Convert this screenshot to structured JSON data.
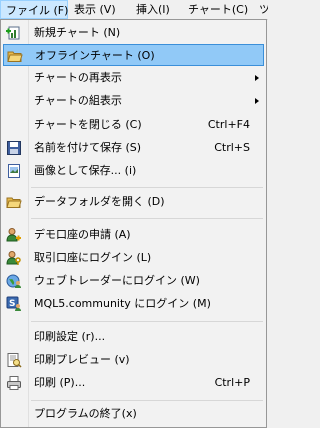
{
  "menubar": {
    "file": "ファイル (F)",
    "view": "表示 (V)",
    "insert": "挿入(I)",
    "chart": "チャート(C)",
    "tools": "ツ"
  },
  "menu": {
    "new_chart": {
      "label": "新規チャート (N)"
    },
    "offline_chart": {
      "label": "オフラインチャート (O)"
    },
    "chart_reshow": {
      "label": "チャートの再表示"
    },
    "chart_tile": {
      "label": "チャートの組表示"
    },
    "close_chart": {
      "label": "チャートを閉じる (C)",
      "shortcut": "Ctrl+F4"
    },
    "save_as": {
      "label": "名前を付けて保存 (S)",
      "shortcut": "Ctrl+S"
    },
    "save_picture": {
      "label": "画像として保存... (i)"
    },
    "open_data_folder": {
      "label": "データフォルダを開く (D)"
    },
    "demo_account": {
      "label": "デモ口座の申請 (A)"
    },
    "login_trade": {
      "label": "取引口座にログイン (L)"
    },
    "login_web_trader": {
      "label": "ウェブトレーダーにログイン (W)"
    },
    "login_mql5": {
      "label": "MQL5.community にログイン (M)"
    },
    "print_setup": {
      "label": "印刷設定 (r)..."
    },
    "print_preview": {
      "label": "印刷プレビュー (v)"
    },
    "print": {
      "label": "印刷 (P)...",
      "shortcut": "Ctrl+P"
    },
    "exit": {
      "label": "プログラムの終了(x)"
    }
  },
  "colors": {
    "highlight_bg": "#91c9f7",
    "highlight_border": "#3b8fd9",
    "menubar_active": "#cce8ff"
  }
}
